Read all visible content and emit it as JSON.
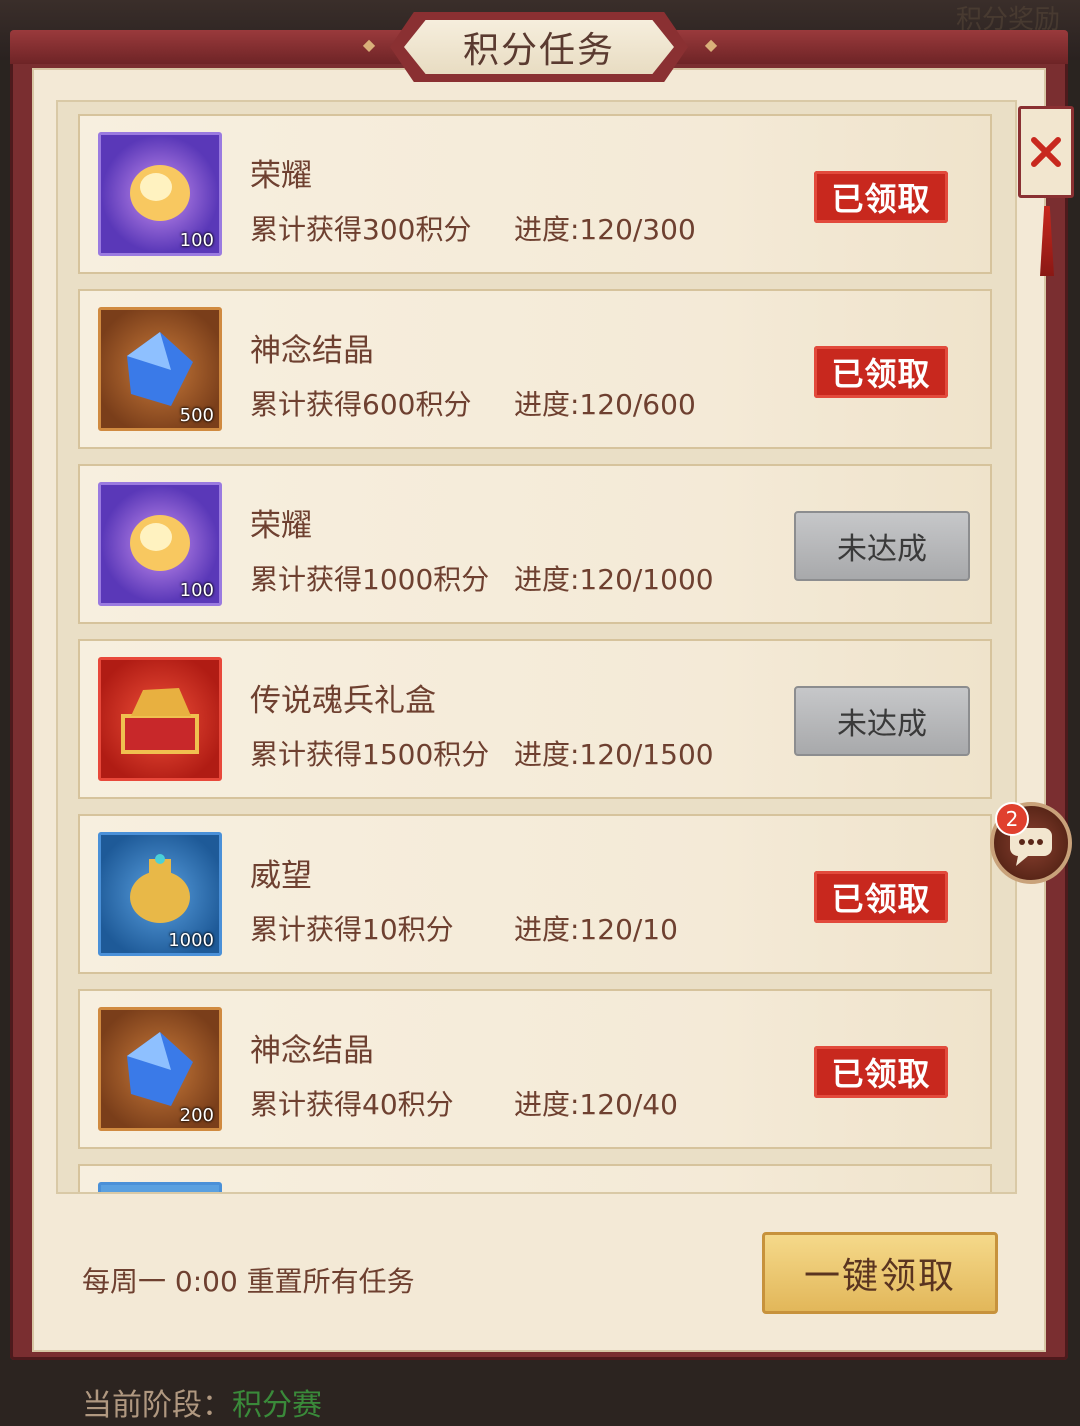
{
  "header": {
    "title": "积分任务",
    "behind_tab": "积分奖励"
  },
  "tasks": [
    {
      "name": "荣耀",
      "quantity": "100",
      "requirement": "累计获得300积分",
      "progress": "进度:120/300",
      "status": "已领取",
      "icon": "glory-orb-icon",
      "icon_theme": "#7a4fc8"
    },
    {
      "name": "神念结晶",
      "quantity": "500",
      "requirement": "累计获得600积分",
      "progress": "进度:120/600",
      "status": "已领取",
      "icon": "blue-crystal-icon",
      "icon_theme": "#b0602a"
    },
    {
      "name": "荣耀",
      "quantity": "100",
      "requirement": "累计获得1000积分",
      "progress": "进度:120/1000",
      "status": "未达成",
      "icon": "glory-orb-icon",
      "icon_theme": "#7a4fc8"
    },
    {
      "name": "传说魂兵礼盒",
      "quantity": "",
      "requirement": "累计获得1500积分",
      "progress": "进度:120/1500",
      "status": "未达成",
      "icon": "treasure-chest-icon",
      "icon_theme": "#d0281c"
    },
    {
      "name": "威望",
      "quantity": "1000",
      "requirement": "累计获得10积分",
      "progress": "进度:120/10",
      "status": "已领取",
      "icon": "golden-urn-icon",
      "icon_theme": "#2e74b8"
    },
    {
      "name": "神念结晶",
      "quantity": "200",
      "requirement": "累计获得40积分",
      "progress": "进度:120/40",
      "status": "已领取",
      "icon": "blue-crystal-icon",
      "icon_theme": "#b0602a"
    }
  ],
  "footer": {
    "reset_note": "每周一 0:00 重置所有任务",
    "claim_all": "一键领取"
  },
  "chat": {
    "badge": "2"
  },
  "bottom": {
    "label": "当前阶段：",
    "stage": "积分赛"
  },
  "colors": {
    "frame": "#7a2e30",
    "panel": "#f3e9d6",
    "claimed_stamp": "#c8281e",
    "not_reached": "#b5b6b8",
    "claim_all_gold": "#e8c06a"
  }
}
